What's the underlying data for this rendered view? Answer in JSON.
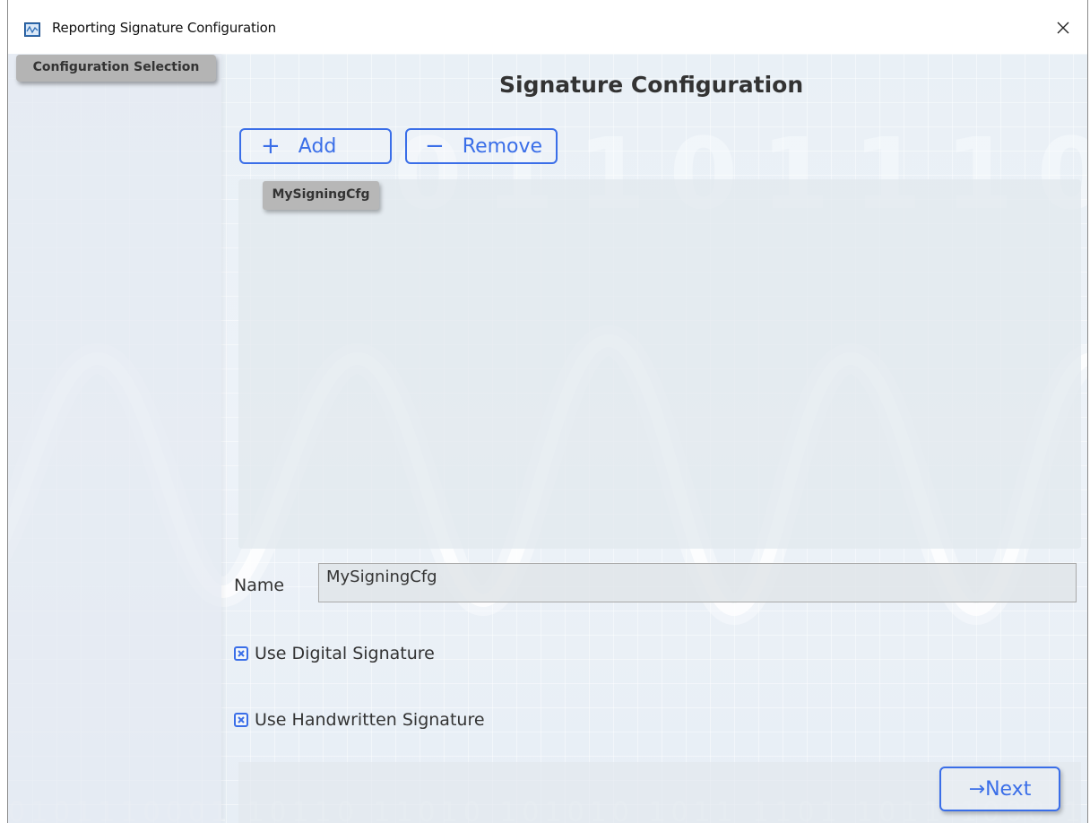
{
  "window": {
    "title": "Reporting Signature Configuration",
    "icon": "chart-window-icon",
    "close_icon": "close-icon"
  },
  "sidebar": {
    "items": [
      {
        "label": "Configuration Selection",
        "selected": true
      }
    ]
  },
  "main": {
    "title": "Signature Configuration",
    "add_button": {
      "glyph": "+",
      "label": "Add",
      "icon": "plus-icon"
    },
    "remove_button": {
      "glyph": "−",
      "label": "Remove",
      "icon": "minus-icon"
    },
    "configurations": [
      {
        "label": "MySigningCfg",
        "selected": true
      }
    ],
    "name_label": "Name",
    "name_value": "MySigningCfg",
    "options": {
      "use_digital": {
        "label": "Use Digital Signature",
        "checked": true
      },
      "use_handwritten": {
        "label": "Use Handwritten Signature",
        "checked": true
      }
    },
    "next_button": {
      "glyph": "→",
      "label": "Next",
      "icon": "arrow-right-icon"
    }
  },
  "colors": {
    "accent": "#3a6ee8",
    "selected_item": "#b4b4b4",
    "background": "#e9f0f6"
  }
}
